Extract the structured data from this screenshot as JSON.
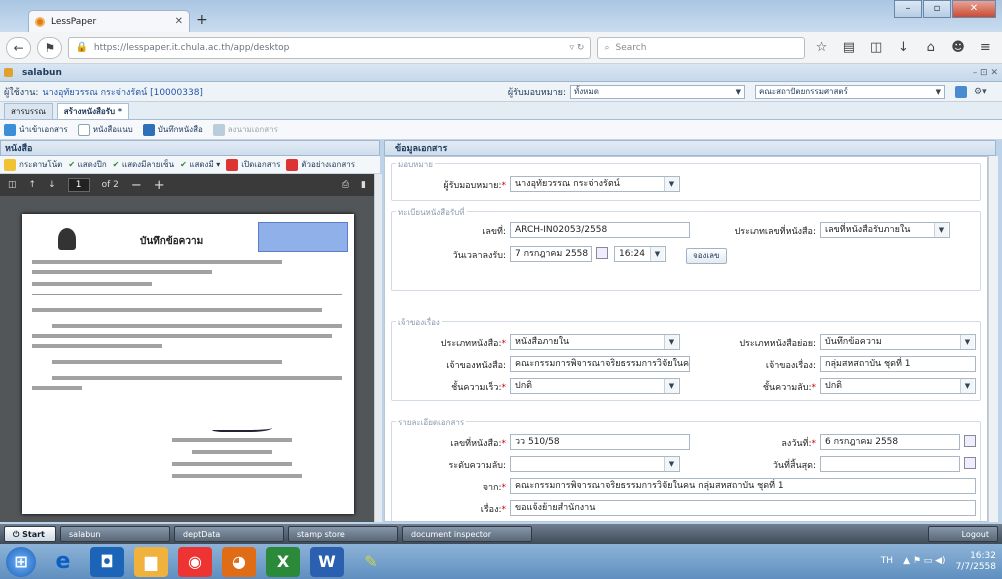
{
  "browser": {
    "tab_title": "LessPaper",
    "url": "https://lesspaper.it.chula.ac.th/app/desktop",
    "search_placeholder": "Search"
  },
  "app": {
    "title": "salabun",
    "user_label": "ผู้ใช้งาน:",
    "user_value": "นางอุทัยวรรณ กระจ่างรัตน์ [10000338]",
    "assign_label": "ผู้รับมอบหมาย:",
    "assign_value": "ทั้งหมด",
    "org_value": "คณะสถาปัตยกรรมศาสตร์",
    "tabs": [
      "สารบรรณ",
      "สร้างหนังสือรับ *"
    ],
    "toolbar": [
      "นำเข้าเอกสาร",
      "หนังสือแนบ",
      "บันทึกหนังสือ",
      "ลงนามเอกสาร"
    ]
  },
  "left": {
    "title": "หนังสือ",
    "tools": [
      "กระดาษโน้ต",
      "แสดงปีก",
      "แสดงมีลายเซ็น",
      "แสดงมี",
      "เปิดเอกสาร",
      "ตัวอย่างเอกสาร"
    ],
    "page_current": "1",
    "page_total": "of 2",
    "doc_heading": "บันทึกข้อความ"
  },
  "form": {
    "title": "ข้อมูลเอกสาร",
    "sec_assign": "มอบหมาย",
    "assignee_label": "ผู้รับมอบหมาย:",
    "assignee_value": "นางอุทัยวรรณ กระจ่างรัตน์",
    "sec_receive": "ทะเบียนหนังสือรับที่",
    "no_label": "เลขที่:",
    "no_value": "ARCH-IN02053/2558",
    "type_no_label": "ประเภทเลขที่หนังสือ:",
    "type_no_value": "เลขที่หนังสือรับภายใน",
    "date_label": "วันเวลาลงรับ:",
    "date_value": "7 กรกฎาคม 2558",
    "time_value": "16:24",
    "reserve_btn": "จองเลข",
    "sec_owner": "เจ้าของเรื่อง",
    "doctype_label": "ประเภทหนังสือ:",
    "doctype_value": "หนังสือภายใน",
    "subtype_label": "ประเภทหนังสือย่อย:",
    "subtype_value": "บันทึกข้อความ",
    "owner_label": "เจ้าของหนังสือ:",
    "owner_value": "คณะกรรมการพิจารณาจริยธรรมการวิจัยในคน",
    "story_owner_label": "เจ้าของเรื่อง:",
    "story_owner_value": "กลุ่มสหสถาบัน ชุดที่ 1",
    "urgency_label": "ชั้นความเร็ว:",
    "urgency_value": "ปกติ",
    "secret_label": "ชั้นความลับ:",
    "secret_value": "ปกติ",
    "sec_detail": "รายละเอียดเอกสาร",
    "docno_label": "เลขที่หนังสือ:",
    "docno_value": "วว 510/58",
    "dated_label": "ลงวันที่:",
    "dated_value": "6 กรกฎาคม 2558",
    "seclevel_label": "ระดับความลับ:",
    "seclevel_value": "",
    "deadline_label": "วันที่สิ้นสุด:",
    "deadline_value": "",
    "from_label": "จาก:",
    "from_value": "คณะกรรมการพิจารณาจริยธรรมการวิจัยในคน กลุ่มสหสถาบัน ชุดที่ 1",
    "subject_label": "เรื่อง:",
    "subject_value": "ขอแจ้งย้ายสำนักงาน"
  },
  "app_taskbar": {
    "start": "Start",
    "items": [
      "salabun",
      "deptData",
      "stamp store",
      "document inspector"
    ],
    "logout": "Logout"
  },
  "os": {
    "lang": "TH",
    "time": "16:32",
    "date": "7/7/2558"
  }
}
